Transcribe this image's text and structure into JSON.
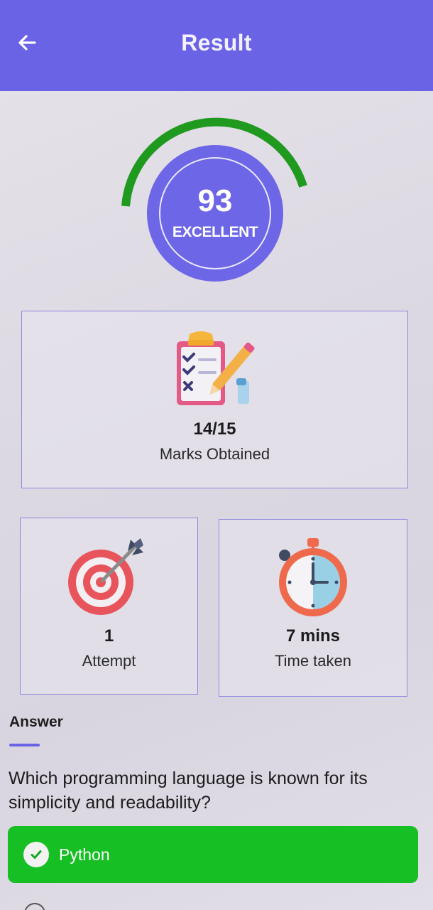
{
  "appbar": {
    "title": "Result",
    "back_icon": "arrow-left-icon"
  },
  "score": {
    "value": "93",
    "grade": "EXCELLENT",
    "ring_color": "#1f9a1f"
  },
  "stats": {
    "marks": {
      "value": "14/15",
      "label": "Marks Obtained",
      "icon": "clipboard-checklist-icon"
    },
    "attempt": {
      "value": "1",
      "label": "Attempt",
      "icon": "target-icon"
    },
    "time": {
      "value": "7 mins",
      "label": "Time taken",
      "icon": "stopwatch-icon"
    }
  },
  "answer": {
    "section_label": "Answer",
    "question": "Which programming language is known for its simplicity and readability?",
    "correct_option": "Python",
    "correct_color": "#16bf23"
  },
  "theme": {
    "primary": "#6b63e6"
  }
}
